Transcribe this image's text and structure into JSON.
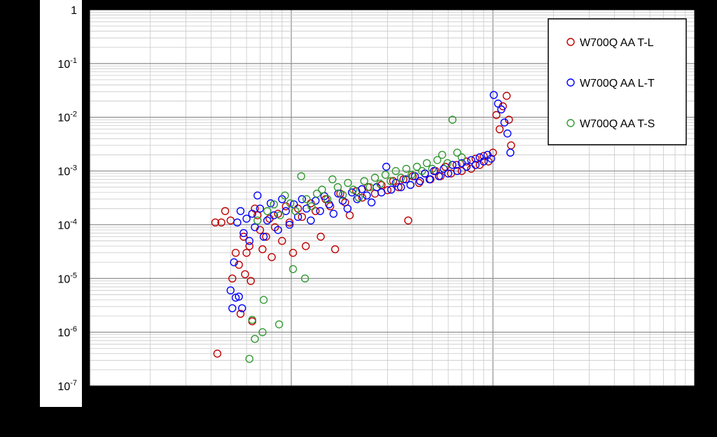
{
  "chart_data": {
    "type": "scatter",
    "title": "",
    "xlabel": "",
    "ylabel": "",
    "x_scale": "log",
    "y_scale": "log",
    "xlim": [
      1,
      1000
    ],
    "ylim": [
      1e-07,
      1
    ],
    "grid": true,
    "legend_position": "top-right",
    "y_tick_labels": [
      {
        "base": "10",
        "exp": "-7",
        "value": 1e-07
      },
      {
        "base": "10",
        "exp": "-6",
        "value": 1e-06
      },
      {
        "base": "10",
        "exp": "-5",
        "value": 1e-05
      },
      {
        "base": "10",
        "exp": "-4",
        "value": 0.0001
      },
      {
        "base": "10",
        "exp": "-3",
        "value": 0.001
      },
      {
        "base": "10",
        "exp": "-2",
        "value": 0.01
      },
      {
        "base": "10",
        "exp": "-1",
        "value": 0.1
      },
      {
        "base": "1",
        "exp": "",
        "value": 1
      }
    ],
    "series": [
      {
        "name": "W700Q AA T-L",
        "color": "#c00000",
        "points": [
          [
            4.3,
            4e-07
          ],
          [
            4.2,
            0.00011
          ],
          [
            4.5,
            0.00011
          ],
          [
            4.7,
            0.00018
          ],
          [
            5.0,
            0.00012
          ],
          [
            5.1,
            1e-05
          ],
          [
            5.3,
            3e-05
          ],
          [
            5.5,
            1.8e-05
          ],
          [
            5.6,
            2.2e-06
          ],
          [
            5.9,
            1.2e-05
          ],
          [
            5.8,
            6e-05
          ],
          [
            6.0,
            3e-05
          ],
          [
            6.2,
            4e-05
          ],
          [
            6.3,
            9e-06
          ],
          [
            6.4,
            1.6e-06
          ],
          [
            6.6,
            0.0002
          ],
          [
            6.8,
            0.00015
          ],
          [
            7.0,
            8e-05
          ],
          [
            7.2,
            3.5e-05
          ],
          [
            7.5,
            6e-05
          ],
          [
            7.8,
            0.00013
          ],
          [
            8.0,
            2.5e-05
          ],
          [
            8.3,
            9e-05
          ],
          [
            8.6,
            0.00016
          ],
          [
            9.0,
            5e-05
          ],
          [
            9.4,
            0.00022
          ],
          [
            9.8,
            0.00011
          ],
          [
            10.2,
            3e-05
          ],
          [
            10.8,
            0.0002
          ],
          [
            11.3,
            0.00014
          ],
          [
            11.8,
            4e-05
          ],
          [
            12.5,
            0.00025
          ],
          [
            13.2,
            0.00018
          ],
          [
            14.0,
            6e-05
          ],
          [
            14.8,
            0.0003
          ],
          [
            15.6,
            0.00022
          ],
          [
            16.5,
            3.5e-05
          ],
          [
            17.5,
            0.00038
          ],
          [
            18.5,
            0.00026
          ],
          [
            19.5,
            0.00015
          ],
          [
            21.0,
            0.00042
          ],
          [
            22.5,
            0.00032
          ],
          [
            24.0,
            0.0005
          ],
          [
            26.0,
            0.00038
          ],
          [
            28.0,
            0.00055
          ],
          [
            30.0,
            0.00044
          ],
          [
            32.0,
            0.00065
          ],
          [
            34.0,
            0.0005
          ],
          [
            36.0,
            0.0007
          ],
          [
            38.0,
            0.00012
          ],
          [
            40.0,
            0.0008
          ],
          [
            43.0,
            0.0006
          ],
          [
            46.0,
            0.0009
          ],
          [
            49.0,
            0.0007
          ],
          [
            52.0,
            0.001
          ],
          [
            55.0,
            0.0008
          ],
          [
            58.0,
            0.0012
          ],
          [
            62.0,
            0.0009
          ],
          [
            66.0,
            0.0013
          ],
          [
            70.0,
            0.001
          ],
          [
            74.0,
            0.0015
          ],
          [
            78.0,
            0.0011
          ],
          [
            82.0,
            0.0017
          ],
          [
            86.0,
            0.0013
          ],
          [
            90.0,
            0.0019
          ],
          [
            95.0,
            0.0015
          ],
          [
            100.0,
            0.0022
          ],
          [
            104.0,
            0.011
          ],
          [
            108.0,
            0.006
          ],
          [
            112.0,
            0.016
          ],
          [
            117.0,
            0.025
          ],
          [
            120.0,
            0.009
          ],
          [
            123.0,
            0.003
          ]
        ]
      },
      {
        "name": "W700Q AA L-T",
        "color": "#0000ff",
        "points": [
          [
            5.0,
            6e-06
          ],
          [
            5.1,
            2.8e-06
          ],
          [
            5.3,
            4.4e-06
          ],
          [
            5.5,
            4.6e-06
          ],
          [
            5.7,
            2.8e-06
          ],
          [
            5.2,
            2e-05
          ],
          [
            5.4,
            0.00011
          ],
          [
            5.6,
            0.00018
          ],
          [
            5.8,
            7e-05
          ],
          [
            6.0,
            0.00013
          ],
          [
            6.2,
            5e-05
          ],
          [
            6.4,
            0.00016
          ],
          [
            6.6,
            9e-05
          ],
          [
            6.8,
            0.00035
          ],
          [
            7.0,
            0.0002
          ],
          [
            7.3,
            6e-05
          ],
          [
            7.6,
            0.00012
          ],
          [
            7.9,
            0.00025
          ],
          [
            8.2,
            0.00015
          ],
          [
            8.6,
            8e-05
          ],
          [
            9.0,
            0.0003
          ],
          [
            9.4,
            0.00018
          ],
          [
            9.8,
            0.0001
          ],
          [
            10.3,
            0.00024
          ],
          [
            10.8,
            0.00014
          ],
          [
            11.3,
            0.0003
          ],
          [
            11.9,
            0.0002
          ],
          [
            12.5,
            0.00012
          ],
          [
            13.2,
            0.00028
          ],
          [
            13.9,
            0.00018
          ],
          [
            14.6,
            0.00034
          ],
          [
            15.4,
            0.00024
          ],
          [
            16.2,
            0.00016
          ],
          [
            17.1,
            0.00038
          ],
          [
            18.0,
            0.00028
          ],
          [
            19.0,
            0.0002
          ],
          [
            20.0,
            0.0004
          ],
          [
            21.2,
            0.0003
          ],
          [
            22.4,
            0.00046
          ],
          [
            23.7,
            0.00035
          ],
          [
            25.0,
            0.00026
          ],
          [
            26.5,
            0.0005
          ],
          [
            28.0,
            0.0004
          ],
          [
            29.6,
            0.0012
          ],
          [
            31.3,
            0.00045
          ],
          [
            33.0,
            0.0006
          ],
          [
            35.0,
            0.0005
          ],
          [
            37.0,
            0.0007
          ],
          [
            39.0,
            0.00055
          ],
          [
            41.0,
            0.0008
          ],
          [
            43.5,
            0.00065
          ],
          [
            46.0,
            0.0009
          ],
          [
            48.5,
            0.0007
          ],
          [
            51.0,
            0.001
          ],
          [
            54.0,
            0.0008
          ],
          [
            57.0,
            0.0011
          ],
          [
            60.0,
            0.0009
          ],
          [
            63.0,
            0.0013
          ],
          [
            66.5,
            0.001
          ],
          [
            70.0,
            0.0014
          ],
          [
            74.0,
            0.0012
          ],
          [
            78.0,
            0.0016
          ],
          [
            82.0,
            0.0013
          ],
          [
            86.0,
            0.0018
          ],
          [
            90.0,
            0.0015
          ],
          [
            94.0,
            0.002
          ],
          [
            98.0,
            0.0017
          ],
          [
            101.0,
            0.026
          ],
          [
            106.0,
            0.018
          ],
          [
            110.0,
            0.014
          ],
          [
            114.0,
            0.008
          ],
          [
            118.0,
            0.005
          ],
          [
            122.0,
            0.0022
          ]
        ]
      },
      {
        "name": "W700Q AA T-S",
        "color": "#339933",
        "points": [
          [
            6.2,
            3.2e-07
          ],
          [
            6.4,
            1.7e-06
          ],
          [
            6.6,
            7.5e-07
          ],
          [
            7.2,
            1e-06
          ],
          [
            7.3,
            4e-06
          ],
          [
            8.7,
            1.4e-06
          ],
          [
            10.2,
            1.5e-05
          ],
          [
            11.7,
            1e-05
          ],
          [
            6.8,
            0.00012
          ],
          [
            7.6,
            0.00018
          ],
          [
            8.2,
            0.00024
          ],
          [
            8.8,
            0.00015
          ],
          [
            9.3,
            0.00035
          ],
          [
            9.9,
            0.00025
          ],
          [
            10.5,
            0.00018
          ],
          [
            11.2,
            0.0008
          ],
          [
            11.9,
            0.0003
          ],
          [
            12.6,
            0.00022
          ],
          [
            13.4,
            0.00038
          ],
          [
            14.2,
            0.00045
          ],
          [
            15.1,
            0.0003
          ],
          [
            16.0,
            0.0007
          ],
          [
            17.0,
            0.0005
          ],
          [
            18.0,
            0.00036
          ],
          [
            19.1,
            0.0006
          ],
          [
            20.3,
            0.00045
          ],
          [
            21.6,
            0.00032
          ],
          [
            23.0,
            0.00065
          ],
          [
            24.5,
            0.0005
          ],
          [
            26.0,
            0.00075
          ],
          [
            27.6,
            0.00058
          ],
          [
            29.3,
            0.00085
          ],
          [
            31.1,
            0.00065
          ],
          [
            33.0,
            0.001
          ],
          [
            35.0,
            0.00075
          ],
          [
            37.2,
            0.0011
          ],
          [
            39.5,
            0.00085
          ],
          [
            42.0,
            0.0012
          ],
          [
            44.5,
            0.001
          ],
          [
            47.0,
            0.0014
          ],
          [
            50.0,
            0.0011
          ],
          [
            53.0,
            0.0016
          ],
          [
            56.0,
            0.002
          ],
          [
            59.5,
            0.0014
          ],
          [
            63.0,
            0.009
          ],
          [
            66.5,
            0.0022
          ],
          [
            70.0,
            0.0018
          ]
        ]
      }
    ]
  }
}
